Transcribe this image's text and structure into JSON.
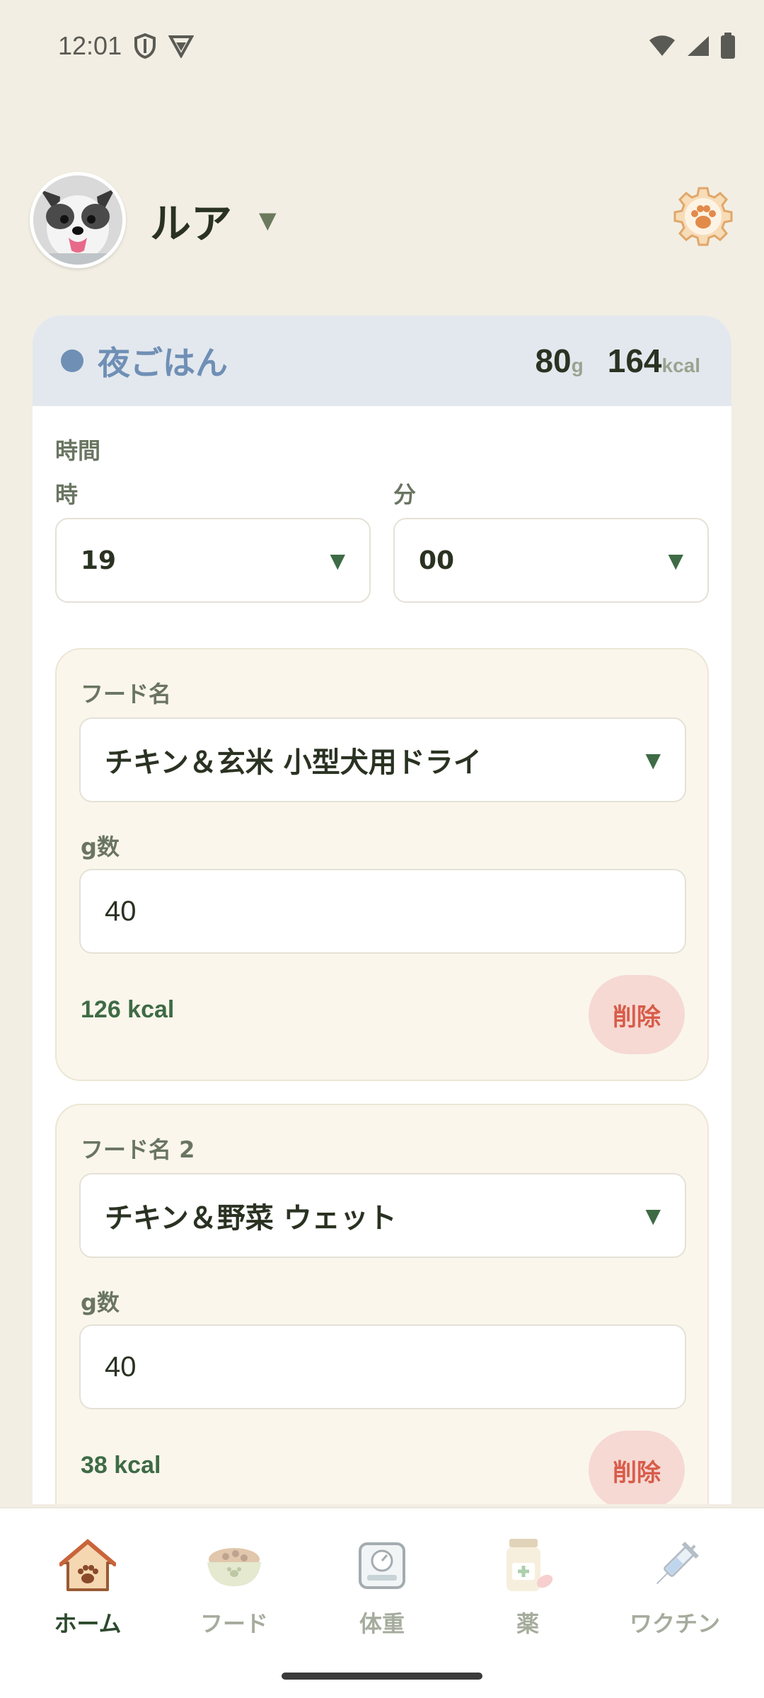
{
  "status_bar": {
    "time": "12:01"
  },
  "header": {
    "pet_name": "ルア",
    "caret": "▼"
  },
  "meal": {
    "title": "夜ごはん",
    "grams": "80",
    "grams_unit": "g",
    "kcal": "164",
    "kcal_unit": "kcal",
    "time_label": "時間",
    "hour_label": "時",
    "minute_label": "分",
    "hour_value": "19",
    "minute_value": "00",
    "caret": "▼"
  },
  "foods": [
    {
      "label": "フード名",
      "name": "チキン＆玄米 小型犬用ドライ",
      "grams_label": "g数",
      "grams": "40",
      "kcal": "126 kcal",
      "delete_label": "削除"
    },
    {
      "label": "フード名 2",
      "name": "チキン＆野菜 ウェット",
      "grams_label": "g数",
      "grams": "40",
      "kcal": "38 kcal",
      "delete_label": "削除"
    }
  ],
  "nav": [
    {
      "label": "ホーム",
      "icon": "home-icon",
      "active": true
    },
    {
      "label": "フード",
      "icon": "food-bowl-icon",
      "active": false
    },
    {
      "label": "体重",
      "icon": "scale-icon",
      "active": false
    },
    {
      "label": "薬",
      "icon": "medicine-icon",
      "active": false
    },
    {
      "label": "ワクチン",
      "icon": "syringe-icon",
      "active": false
    }
  ],
  "colors": {
    "background": "#f2eee3",
    "meal_accent": "#6f8fb5",
    "kcal_green": "#3e6b45",
    "delete_red": "#d85c4a",
    "delete_bg": "#f6d9d3"
  }
}
